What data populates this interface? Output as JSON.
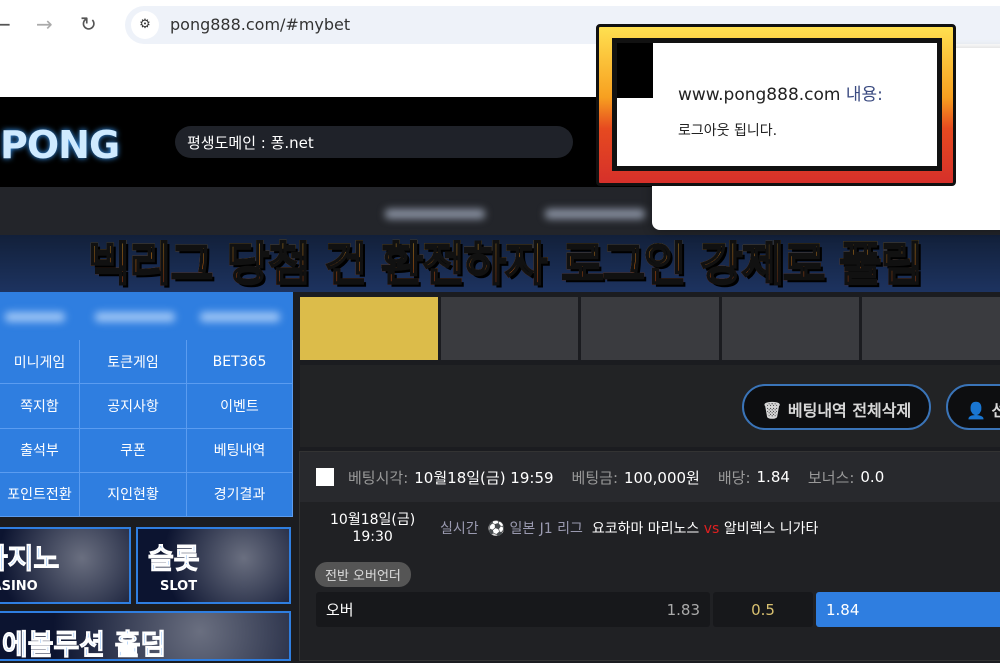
{
  "browser": {
    "url": "pong888.com/#mybet",
    "icons": [
      "back-arrow-icon",
      "forward-arrow-icon",
      "reload-icon",
      "site-settings-icon"
    ]
  },
  "header": {
    "logo": "PONG",
    "domain_notice": "평생도메인 : 퐁.net"
  },
  "headline": "빅리그 당첨 건 환전하자 로그인 강제로 풀림",
  "menu": [
    "미니게임",
    "토큰게임",
    "BET365",
    "쪽지함",
    "공지사항",
    "이벤트",
    "출석부",
    "쿠폰",
    "베팅내역",
    "포인트전환",
    "지인현황",
    "경기결과"
  ],
  "promos": [
    {
      "big": "카지노",
      "small": "CASINO"
    },
    {
      "big": "슬롯",
      "small": "SLOT"
    },
    {
      "big": "에볼루션 홀덤"
    }
  ],
  "tools": {
    "delete_all": "베팅내역 전체삭제",
    "next": "선"
  },
  "bet": {
    "time_label": "베팅시각:",
    "time": "10월18일(금) 19:59",
    "amount_label": "베팅금:",
    "amount": "100,000원",
    "odds_label": "배당:",
    "odds": "1.84",
    "bonus_label": "보너스:",
    "bonus": "0.0",
    "match_date": "10월18일(금)",
    "match_time": "19:30",
    "live": "실시간",
    "league": "일본 J1 리그",
    "home": "요코하마 마리노스",
    "vs": "vs",
    "away": "알비렉스 니가타",
    "market": "전반 오버언더",
    "selection": "오버",
    "home_odds": "1.83",
    "line": "0.5",
    "away_odds": "1.84"
  },
  "alert": {
    "origin": "www.pong888.com",
    "suffix": "내용:",
    "message": "로그아웃 됩니다."
  },
  "colors": {
    "accent_blue": "#2f7ee0",
    "tab_active": "#dcbc4a",
    "vs": "#e02020"
  }
}
